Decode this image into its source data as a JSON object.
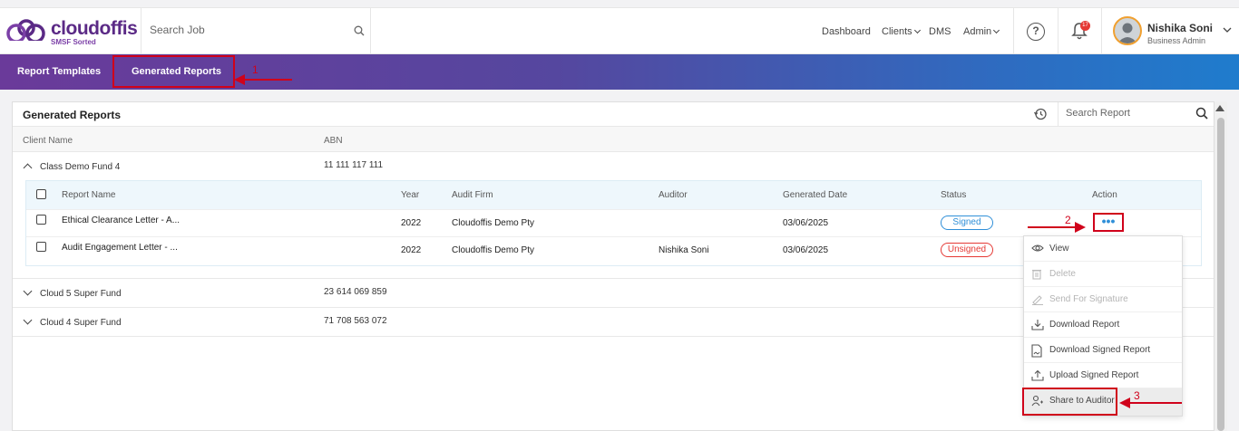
{
  "header": {
    "logo_text": "cloudoffis",
    "logo_sub": "SMSF Sorted",
    "search_placeholder": "Search Job",
    "nav": {
      "dashboard": "Dashboard",
      "clients": "Clients",
      "dms": "DMS",
      "admin": "Admin"
    },
    "notification_count": "17",
    "user_name": "Nishika Soni",
    "user_role": "Business Admin"
  },
  "tabs": {
    "report_templates": "Report Templates",
    "generated_reports": "Generated Reports"
  },
  "card": {
    "title": "Generated Reports",
    "search_placeholder": "Search Report",
    "columns": {
      "client_name": "Client Name",
      "abn": "ABN"
    },
    "groups": [
      {
        "name": "Class Demo Fund 4",
        "abn": "11 111 117 111",
        "expanded": true
      },
      {
        "name": "Cloud 5 Super Fund",
        "abn": "23 614 069 859",
        "expanded": false
      },
      {
        "name": "Cloud 4 Super Fund",
        "abn": "71 708 563 072",
        "expanded": false
      }
    ],
    "sub_columns": {
      "report_name": "Report Name",
      "year": "Year",
      "audit_firm": "Audit Firm",
      "auditor": "Auditor",
      "generated_date": "Generated Date",
      "status": "Status",
      "action": "Action"
    },
    "rows": [
      {
        "report_name": "Ethical Clearance Letter - A...",
        "year": "2022",
        "audit_firm": "Cloudoffis Demo Pty",
        "auditor": "",
        "generated_date": "03/06/2025",
        "status": "Signed"
      },
      {
        "report_name": "Audit Engagement Letter - ...",
        "year": "2022",
        "audit_firm": "Cloudoffis Demo Pty",
        "auditor": "Nishika Soni",
        "generated_date": "03/06/2025",
        "status": "Unsigned"
      }
    ],
    "action_dots": "•••"
  },
  "action_menu": [
    {
      "label": "View",
      "icon": "eye-icon",
      "disabled": false
    },
    {
      "label": "Delete",
      "icon": "trash-icon",
      "disabled": true
    },
    {
      "label": "Send For Signature",
      "icon": "signature-icon",
      "disabled": true
    },
    {
      "label": "Download Report",
      "icon": "download-icon",
      "disabled": false
    },
    {
      "label": "Download Signed Report",
      "icon": "signed-document-icon",
      "disabled": false
    },
    {
      "label": "Upload Signed Report",
      "icon": "upload-icon",
      "disabled": false
    },
    {
      "label": "Share to Auditor",
      "icon": "share-user-icon",
      "disabled": false
    }
  ],
  "annotations": {
    "step1": "1",
    "step2": "2",
    "step3": "3"
  },
  "colors": {
    "brand_purple": "#5b2a86",
    "band_start": "#6a3a9a",
    "band_end": "#1f7ccd",
    "annotation_red": "#d0021b",
    "signed_blue": "#2f8fd8",
    "unsigned_red": "#e53935"
  }
}
